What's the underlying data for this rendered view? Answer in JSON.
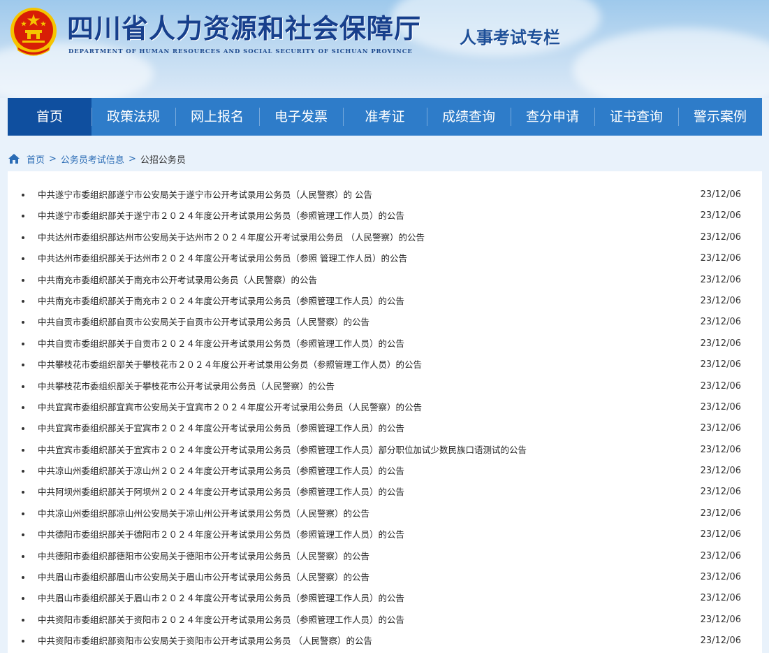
{
  "header": {
    "site_title": "四川省人力资源和社会保障厅",
    "site_subtitle": "DEPARTMENT OF HUMAN RESOURCES AND SOCIAL SECURITY OF SICHUAN PROVINCE",
    "column_title": "人事考试专栏"
  },
  "nav": {
    "items": [
      "首页",
      "政策法规",
      "网上报名",
      "电子发票",
      "准考证",
      "成绩查询",
      "查分申请",
      "证书查询",
      "警示案例"
    ],
    "active_index": 0
  },
  "breadcrumb": {
    "home": "首页",
    "separator": ">",
    "level1": "公务员考试信息",
    "current": "公招公务员"
  },
  "articles": [
    {
      "title": "中共遂宁市委组织部遂宁市公安局关于遂宁市公开考试录用公务员（人民警察）的 公告",
      "date": "23/12/06"
    },
    {
      "title": "中共遂宁市委组织部关于遂宁市２０２４年度公开考试录用公务员（参照管理工作人员）的公告",
      "date": "23/12/06"
    },
    {
      "title": "中共达州市委组织部达州市公安局关于达州市２０２４年度公开考试录用公务员 （人民警察）的公告",
      "date": "23/12/06"
    },
    {
      "title": "中共达州市委组织部关于达州市２０２４年度公开考试录用公务员（参照 管理工作人员）的公告",
      "date": "23/12/06"
    },
    {
      "title": "中共南充市委组织部关于南充市公开考试录用公务员（人民警察）的公告",
      "date": "23/12/06"
    },
    {
      "title": "中共南充市委组织部关于南充市２０２４年度公开考试录用公务员（参照管理工作人员）的公告",
      "date": "23/12/06"
    },
    {
      "title": "中共自贡市委组织部自贡市公安局关于自贡市公开考试录用公务员（人民警察）的公告",
      "date": "23/12/06"
    },
    {
      "title": "中共自贡市委组织部关于自贡市２０２４年度公开考试录用公务员（参照管理工作人员）的公告",
      "date": "23/12/06"
    },
    {
      "title": "中共攀枝花市委组织部关于攀枝花市２０２４年度公开考试录用公务员（参照管理工作人员）的公告",
      "date": "23/12/06"
    },
    {
      "title": "中共攀枝花市委组织部关于攀枝花市公开考试录用公务员（人民警察）的公告",
      "date": "23/12/06"
    },
    {
      "title": "中共宜宾市委组织部宜宾市公安局关于宜宾市２０２４年度公开考试录用公务员（人民警察）的公告",
      "date": "23/12/06"
    },
    {
      "title": "中共宜宾市委组织部关于宜宾市２０２４年度公开考试录用公务员（参照管理工作人员）的公告",
      "date": "23/12/06"
    },
    {
      "title": "中共宜宾市委组织部关于宜宾市２０２４年度公开考试录用公务员（参照管理工作人员）部分职位加试少数民族口语测试的公告",
      "date": "23/12/06"
    },
    {
      "title": "中共凉山州委组织部关于凉山州２０２４年度公开考试录用公务员（参照管理工作人员）的公告",
      "date": "23/12/06"
    },
    {
      "title": "中共阿坝州委组织部关于阿坝州２０２４年度公开考试录用公务员（参照管理工作人员）的公告",
      "date": "23/12/06"
    },
    {
      "title": "中共凉山州委组织部凉山州公安局关于凉山州公开考试录用公务员（人民警察）的公告",
      "date": "23/12/06"
    },
    {
      "title": "中共德阳市委组织部关于德阳市２０２４年度公开考试录用公务员（参照管理工作人员）的公告",
      "date": "23/12/06"
    },
    {
      "title": "中共德阳市委组织部德阳市公安局关于德阳市公开考试录用公务员（人民警察）的公告",
      "date": "23/12/06"
    },
    {
      "title": "中共眉山市委组织部眉山市公安局关于眉山市公开考试录用公务员（人民警察）的公告",
      "date": "23/12/06"
    },
    {
      "title": "中共眉山市委组织部关于眉山市２０２４年度公开考试录用公务员（参照管理工作人员）的公告",
      "date": "23/12/06"
    },
    {
      "title": "中共资阳市委组织部关于资阳市２０２４年度公开考试录用公务员（参照管理工作人员）的公告",
      "date": "23/12/06"
    },
    {
      "title": "中共资阳市委组织部资阳市公安局关于资阳市公开考试录用公务员 （人民警察）的公告",
      "date": "23/12/06"
    }
  ],
  "colors": {
    "nav_bg": "#2e7cc9",
    "nav_active": "#0f4f9f",
    "title_blue": "#173f8c",
    "link_blue": "#2b6cb5",
    "emblem_red": "#d81e06",
    "emblem_gold": "#f5c400"
  },
  "icons": {
    "emblem": "national-emblem",
    "breadcrumb_home": "home-icon"
  }
}
